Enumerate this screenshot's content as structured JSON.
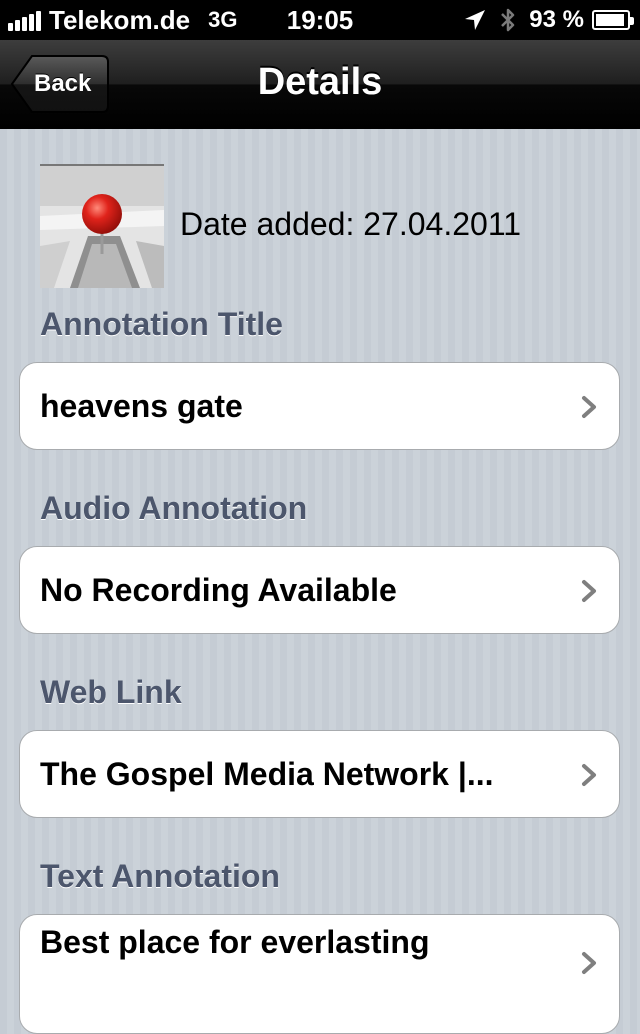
{
  "status_bar": {
    "carrier": "Telekom.de",
    "network": "3G",
    "time": "19:05",
    "battery": "93 %",
    "battery_level": 0.93
  },
  "nav": {
    "back_label": "Back",
    "title": "Details"
  },
  "header": {
    "date_added": "Date added: 27.04.2011"
  },
  "sections": [
    {
      "label": "Annotation Title",
      "value": "heavens gate"
    },
    {
      "label": "Audio Annotation",
      "value": "No Recording Available"
    },
    {
      "label": "Web Link",
      "value": "The Gospel Media Network |..."
    },
    {
      "label": "Text Annotation",
      "value": "Best place for everlasting"
    }
  ],
  "colors": {
    "section_label": "#4c566c",
    "background": "#c5ccd4",
    "pin": "#e0231b"
  },
  "icons": [
    "location-arrow-icon",
    "bluetooth-icon",
    "battery-icon",
    "chevron-right-icon",
    "map-pin-icon"
  ]
}
